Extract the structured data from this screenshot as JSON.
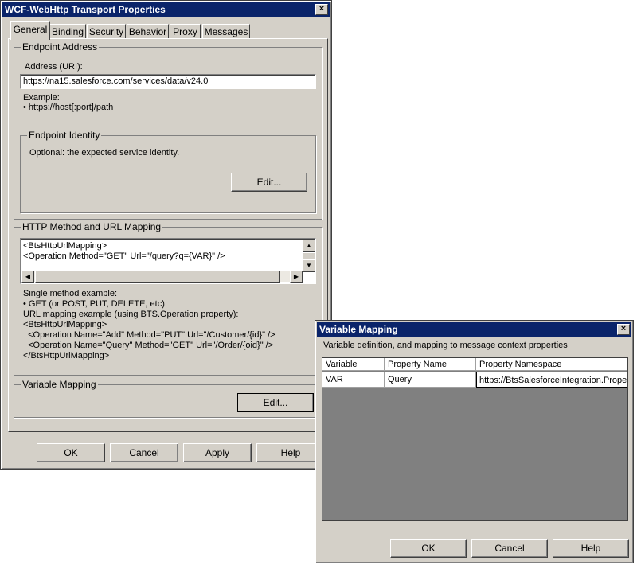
{
  "main_window": {
    "title": "WCF-WebHttp Transport Properties",
    "close_glyph": "×",
    "tabs": [
      {
        "label": "General",
        "active": true
      },
      {
        "label": "Binding"
      },
      {
        "label": "Security"
      },
      {
        "label": "Behavior"
      },
      {
        "label": "Proxy"
      },
      {
        "label": "Messages"
      }
    ],
    "endpoint_address": {
      "group_label": "Endpoint Address",
      "address_label": "Address (URI):",
      "address_value": "https://na15.salesforce.com/services/data/v24.0",
      "example_line1": "Example:",
      "example_line2": "• https://host[:port]/path"
    },
    "endpoint_identity": {
      "group_label": "Endpoint Identity",
      "description": "Optional: the expected service identity.",
      "edit_label": "Edit..."
    },
    "http_mapping": {
      "group_label": "HTTP Method and URL Mapping",
      "textarea_lines": [
        "<BtsHttpUrlMapping>",
        "<Operation Method=\"GET\" Url=\"/query?q={VAR}\" />"
      ],
      "help_lines": [
        "Single method example:",
        "• GET (or POST, PUT, DELETE, etc)",
        "URL mapping example (using BTS.Operation property):",
        "<BtsHttpUrlMapping>",
        "  <Operation Name=\"Add\" Method=\"PUT\" Url=\"/Customer/{id}\" />",
        "  <Operation Name=\"Query\" Method=\"GET\" Url=\"/Order/{oid}\" />",
        "</BtsHttpUrlMapping>"
      ]
    },
    "variable_mapping": {
      "group_label": "Variable Mapping",
      "edit_label": "Edit..."
    },
    "buttons": {
      "ok": "OK",
      "cancel": "Cancel",
      "apply": "Apply",
      "help": "Help"
    }
  },
  "variable_dialog": {
    "title": "Variable Mapping",
    "close_glyph": "×",
    "description": "Variable definition, and mapping to message context properties",
    "columns": [
      "Variable",
      "Property Name",
      "Property Namespace"
    ],
    "rows": [
      {
        "variable": "VAR",
        "property_name": "Query",
        "property_namespace": "https://BtsSalesforceIntegration.Proper"
      }
    ],
    "buttons": {
      "ok": "OK",
      "cancel": "Cancel",
      "help": "Help"
    }
  },
  "icons": {
    "scroll_up": "▲",
    "scroll_down": "▼",
    "scroll_left": "◀",
    "scroll_right": "▶"
  }
}
